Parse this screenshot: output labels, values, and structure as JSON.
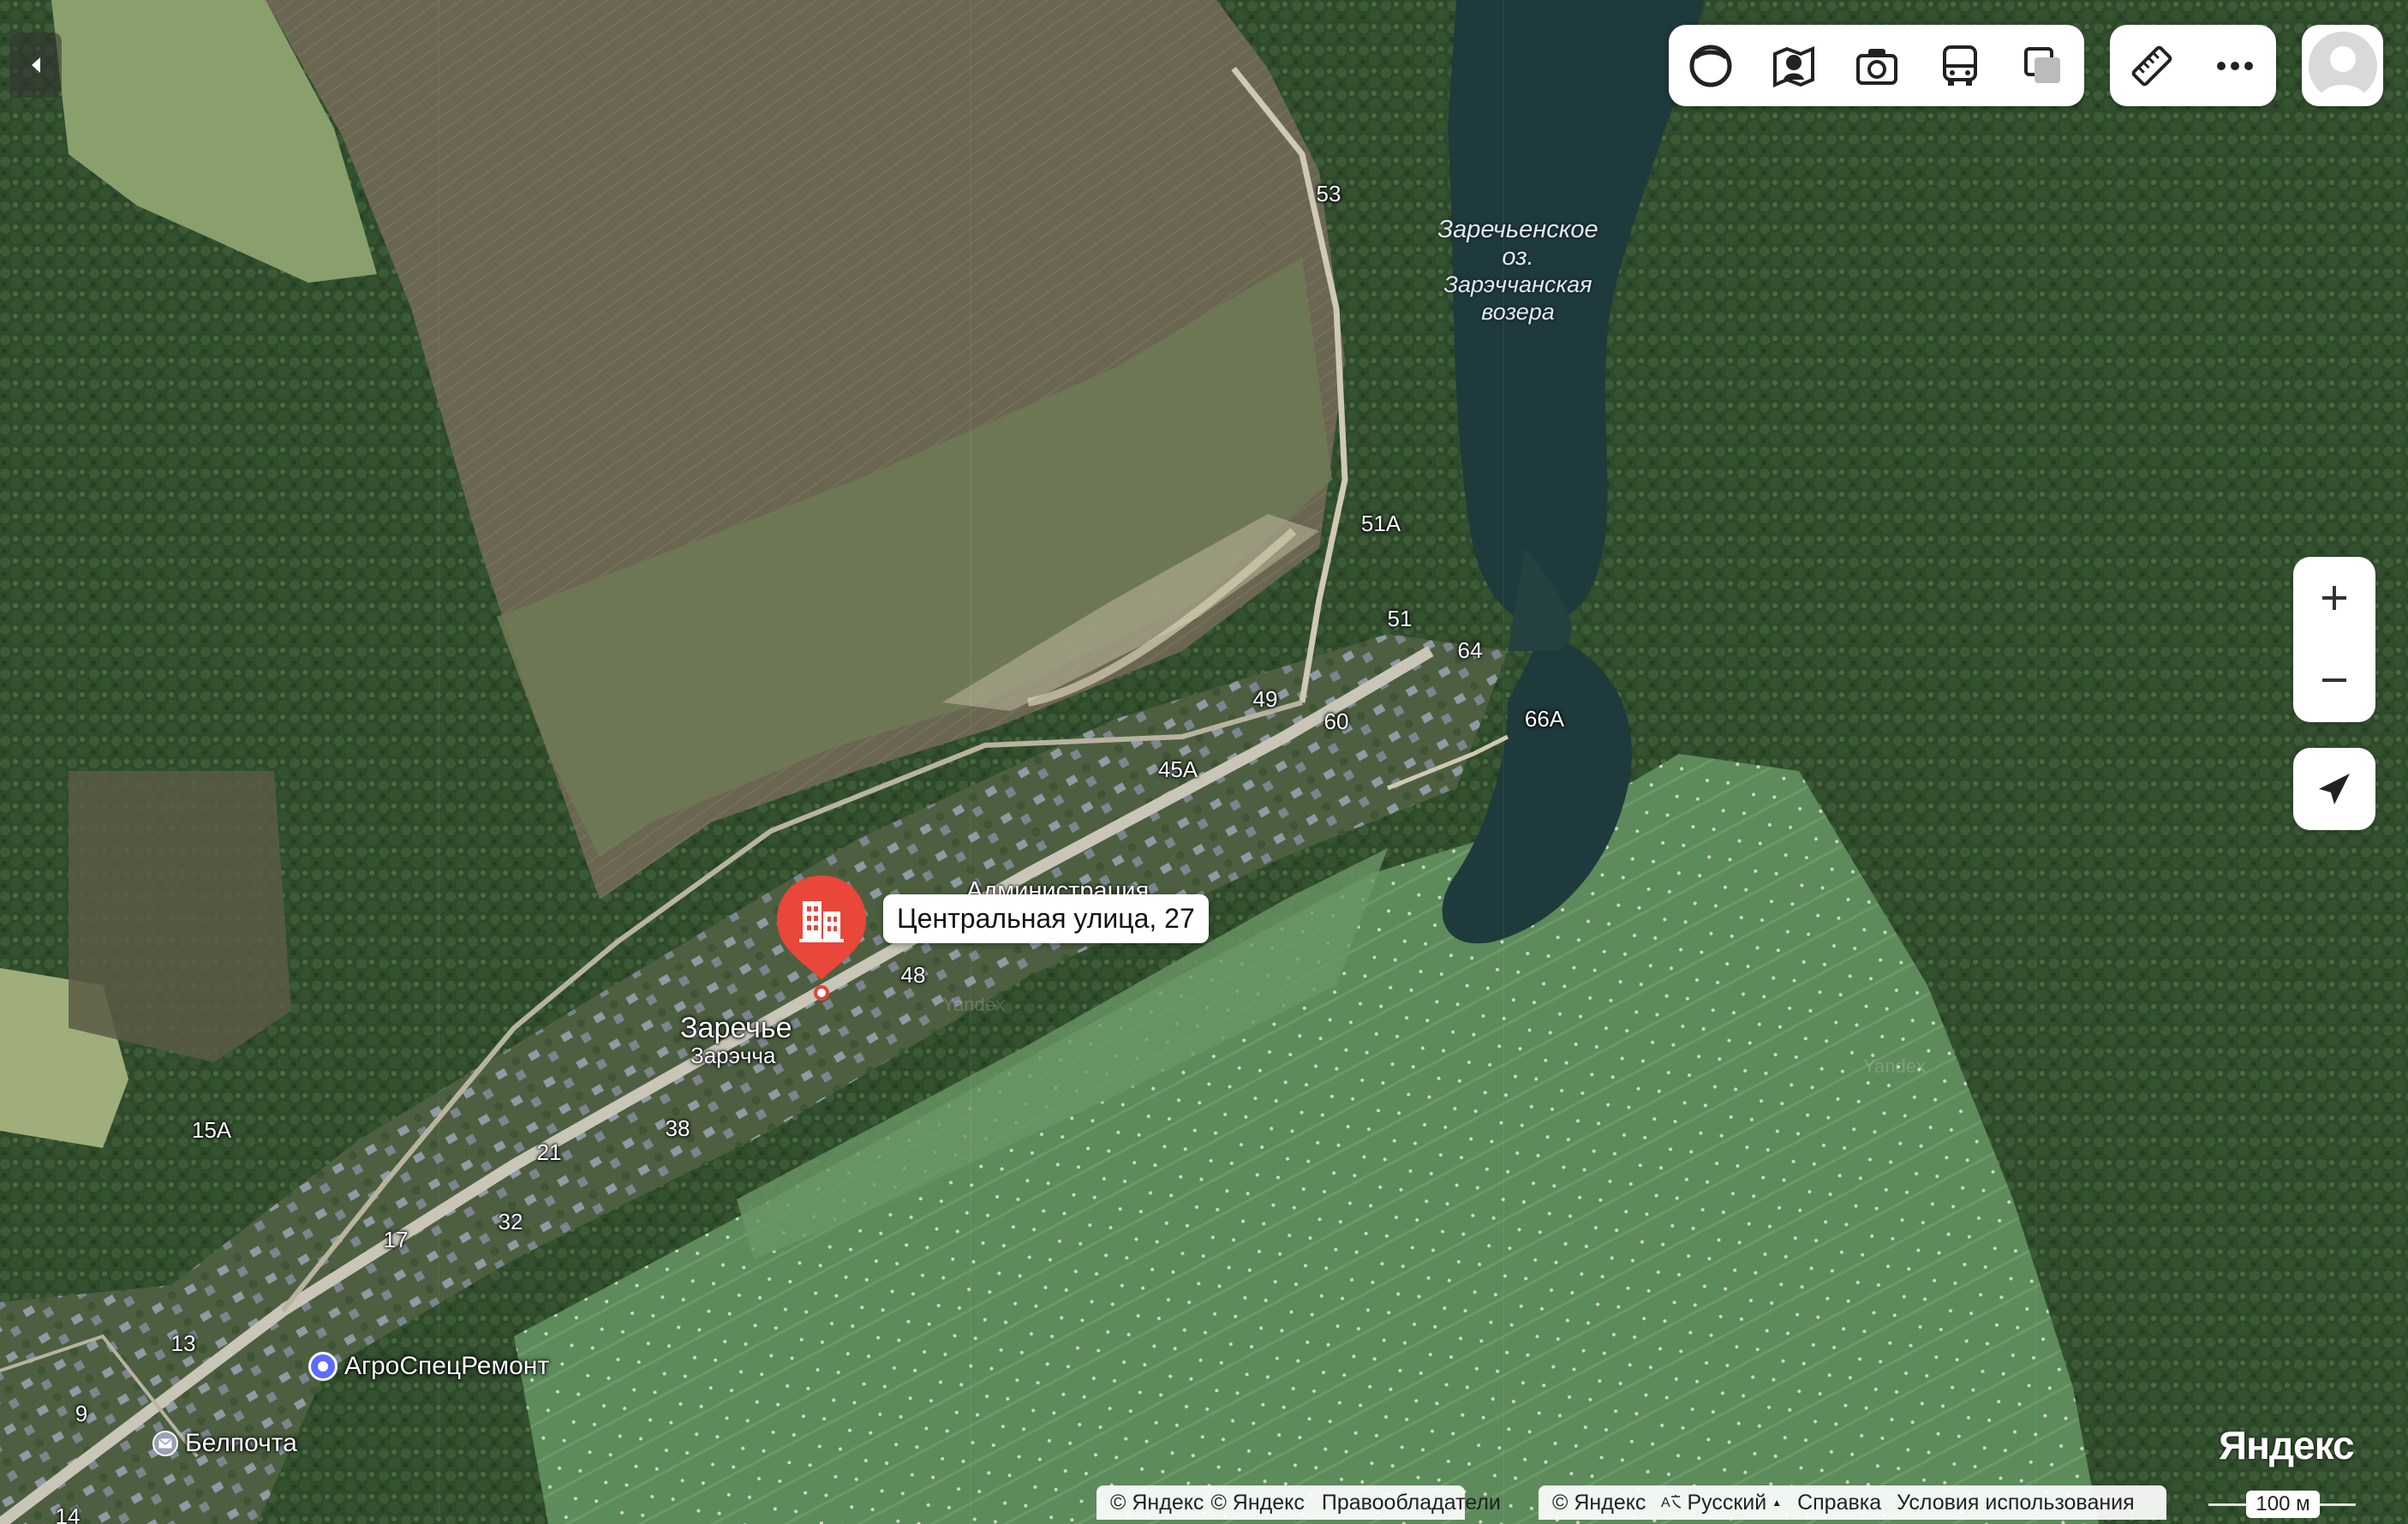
{
  "map": {
    "lake_name_ru": "Заречьенское",
    "lake_type_ru": "оз.",
    "lake_name_be": "Зарэччанская",
    "lake_type_be": "возера",
    "village_name": "Заречье",
    "village_name_be": "Зарэчча",
    "selected": {
      "address": "Центральная улица, 27",
      "category_label": "Администрация",
      "icon": "building-icon",
      "color": "#e8473a"
    },
    "pois": [
      {
        "name": "АгроСпецРемонт",
        "icon": "poi-dot-icon",
        "color": "#5b6cff"
      },
      {
        "name": "Белпочта",
        "icon": "mail-icon",
        "color": "#9aa0b5"
      }
    ],
    "house_numbers": [
      "53",
      "51А",
      "51",
      "64",
      "49",
      "60",
      "66А",
      "45А",
      "48",
      "38",
      "21",
      "15А",
      "32",
      "17",
      "13",
      "9",
      "14"
    ],
    "watermark": "Yandex"
  },
  "toolbar": {
    "layers": [
      {
        "name": "panorama-layer",
        "icon": "panorama-icon"
      },
      {
        "name": "traffic-layer",
        "icon": "traffic-icon"
      },
      {
        "name": "photos-layer",
        "icon": "camera-icon"
      },
      {
        "name": "transit-layer",
        "icon": "bus-icon"
      },
      {
        "name": "map-type",
        "icon": "layers-icon"
      }
    ],
    "extras": [
      {
        "name": "ruler",
        "icon": "ruler-icon"
      },
      {
        "name": "more",
        "icon": "more-icon"
      }
    ]
  },
  "controls": {
    "zoom_in": "+",
    "zoom_out": "−"
  },
  "footer": {
    "brand": "Яндекс",
    "copyright_1": "© Яндекс",
    "copyright_2": "© Яндекс",
    "rights_holders": "Правообладатели",
    "copyright_3": "© Яндекс",
    "language": "Русский",
    "language_caret": "▲",
    "help": "Справка",
    "terms": "Условия использования",
    "scale": "100 м"
  }
}
